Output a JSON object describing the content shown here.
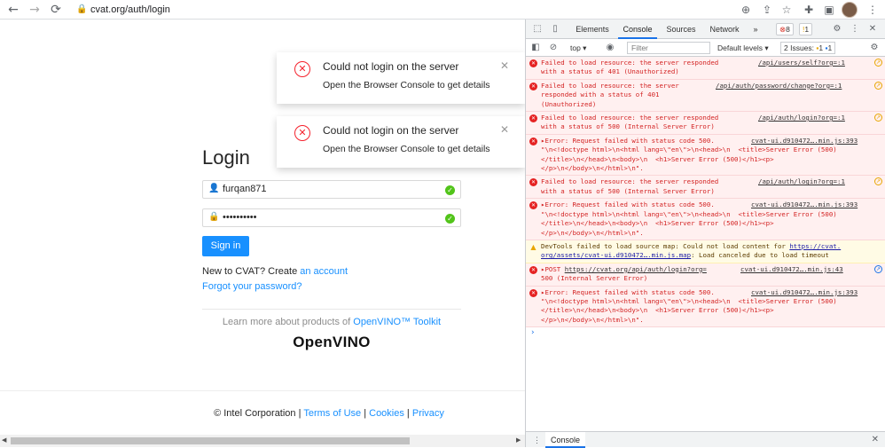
{
  "browser": {
    "url": "cvat.org/auth/login",
    "back_icon": "←",
    "forward_icon": "→",
    "reload_icon": "⟳"
  },
  "login": {
    "title": "Login",
    "username": "furqan871",
    "password": "••••••••••",
    "signin_label": "Sign in",
    "new_to": "New to CVAT? Create ",
    "create_link": "an account",
    "forgot_link": "Forgot your password?",
    "learn_prefix": "Learn more about products of ",
    "learn_link": "OpenVINO™ Toolkit",
    "logo_text": "OpenVINO"
  },
  "footer": {
    "corp": "© Intel Corporation",
    "terms": "Terms of Use",
    "cookies": "Cookies",
    "privacy": "Privacy",
    "sep": " | "
  },
  "notifications": [
    {
      "title": "Could not login on the server",
      "desc": "Open the Browser Console to get details"
    },
    {
      "title": "Could not login on the server",
      "desc": "Open the Browser Console to get details"
    }
  ],
  "devtools": {
    "tabs": [
      "Elements",
      "Console",
      "Sources",
      "Network"
    ],
    "more": "»",
    "error_count": "8",
    "warn_count": "1",
    "context": "top ▾",
    "filter_placeholder": "Filter",
    "levels": "Default levels ▾",
    "issues_label": "2 Issues:",
    "issues_warn": "1",
    "issues_info": "1",
    "drawer_tab": "Console",
    "messages": [
      {
        "kind": "error",
        "body": "Failed to load resource: the server responded\nwith a status of 401 (Unauthorized)",
        "src": "/api/users/self?org=:1"
      },
      {
        "kind": "error",
        "body": "Failed to load resource: the server\nresponded with a status of 401\n(Unauthorized)",
        "src": "/api/auth/password/change?org=:1"
      },
      {
        "kind": "error",
        "body": "Failed to load resource: the server responded\nwith a status of 500 (Internal Server Error)",
        "src": "/api/auth/login?org=:1"
      },
      {
        "kind": "error",
        "body": "▸Error: Request failed with status code 500.\n\"\\n<!doctype html>\\n<html lang=\\\"en\\\">\\n<head>\\n  <title>Server Error (500)\n</title>\\n</head>\\n<body>\\n  <h1>Server Error (500)</h1><p>\n</p>\\n</body>\\n</html>\\n\".",
        "src": "cvat-ui.d910472….min.js:393"
      },
      {
        "kind": "error",
        "body": "Failed to load resource: the server responded\nwith a status of 500 (Internal Server Error)",
        "src": "/api/auth/login?org=:1"
      },
      {
        "kind": "error",
        "body": "▸Error: Request failed with status code 500.\n\"\\n<!doctype html>\\n<html lang=\\\"en\\\">\\n<head>\\n  <title>Server Error (500)\n</title>\\n</head>\\n<body>\\n  <h1>Server Error (500)</h1><p>\n</p>\\n</body>\\n</html>\\n\".",
        "src": "cvat-ui.d910472….min.js:393"
      },
      {
        "kind": "warn",
        "prefix": "DevTools failed to load source map: Could not load content for ",
        "link1": "https://cvat.",
        "link2": "org/assets/cvat-ui.d910472….min.js.map",
        "suffix": ": Load canceled due to load timeout"
      },
      {
        "kind": "error",
        "prefix": "▸POST ",
        "link1": "https://cvat.org/api/auth/login?org=",
        "line2": "500 (Internal Server Error)",
        "src": "cvat-ui.d910472….min.js:43"
      },
      {
        "kind": "error",
        "body": "▸Error: Request failed with status code 500.\n\"\\n<!doctype html>\\n<html lang=\\\"en\\\">\\n<head>\\n  <title>Server Error (500)\n</title>\\n</head>\\n<body>\\n  <h1>Server Error (500)</h1><p>\n</p>\\n</body>\\n</html>\\n\".",
        "src": "cvat-ui.d910472….min.js:393"
      }
    ]
  }
}
